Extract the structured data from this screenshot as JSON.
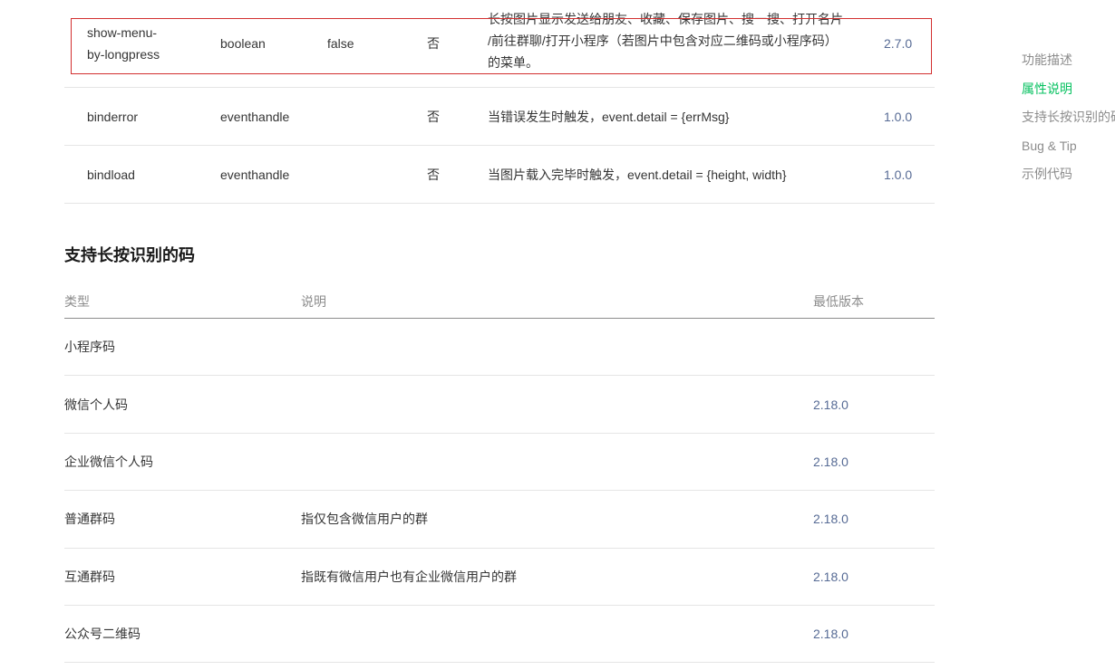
{
  "attributes": {
    "rows": [
      {
        "name_lines": [
          "show-menu-",
          "by-longpress"
        ],
        "type": "boolean",
        "default": "false",
        "required": "否",
        "description_lines": [
          "长按图片显示发送给朋友、收藏、保存图片、搜一搜、打开名片",
          "/前往群聊/打开小程序（若图片中包含对应二维码或小程序码）",
          "的菜单。"
        ],
        "version": "2.7.0"
      },
      {
        "name": "binderror",
        "type": "eventhandle",
        "default": "",
        "required": "否",
        "description": "当错误发生时触发，event.detail = {errMsg}",
        "version": "1.0.0"
      },
      {
        "name": "bindload",
        "type": "eventhandle",
        "default": "",
        "required": "否",
        "description": "当图片载入完毕时触发，event.detail = {height, width}",
        "version": "1.0.0"
      }
    ]
  },
  "section": {
    "title": "支持长按识别的码"
  },
  "codes_table": {
    "headers": [
      "类型",
      "说明",
      "最低版本"
    ],
    "rows": [
      {
        "type": "小程序码",
        "desc": "",
        "version": ""
      },
      {
        "type": "微信个人码",
        "desc": "",
        "version": "2.18.0"
      },
      {
        "type": "企业微信个人码",
        "desc": "",
        "version": "2.18.0"
      },
      {
        "type": "普通群码",
        "desc": "指仅包含微信用户的群",
        "version": "2.18.0"
      },
      {
        "type": "互通群码",
        "desc": "指既有微信用户也有企业微信用户的群",
        "version": "2.18.0"
      },
      {
        "type": "公众号二维码",
        "desc": "",
        "version": "2.18.0"
      }
    ]
  },
  "toc": {
    "items": [
      "功能描述",
      "属性说明",
      "支持长按识别的码",
      "Bug & Tip",
      "示例代码"
    ],
    "active_index": 1
  },
  "colors": {
    "accent_green": "#07c160",
    "link_blue": "#576b95",
    "highlight_red": "#d32f2f"
  }
}
